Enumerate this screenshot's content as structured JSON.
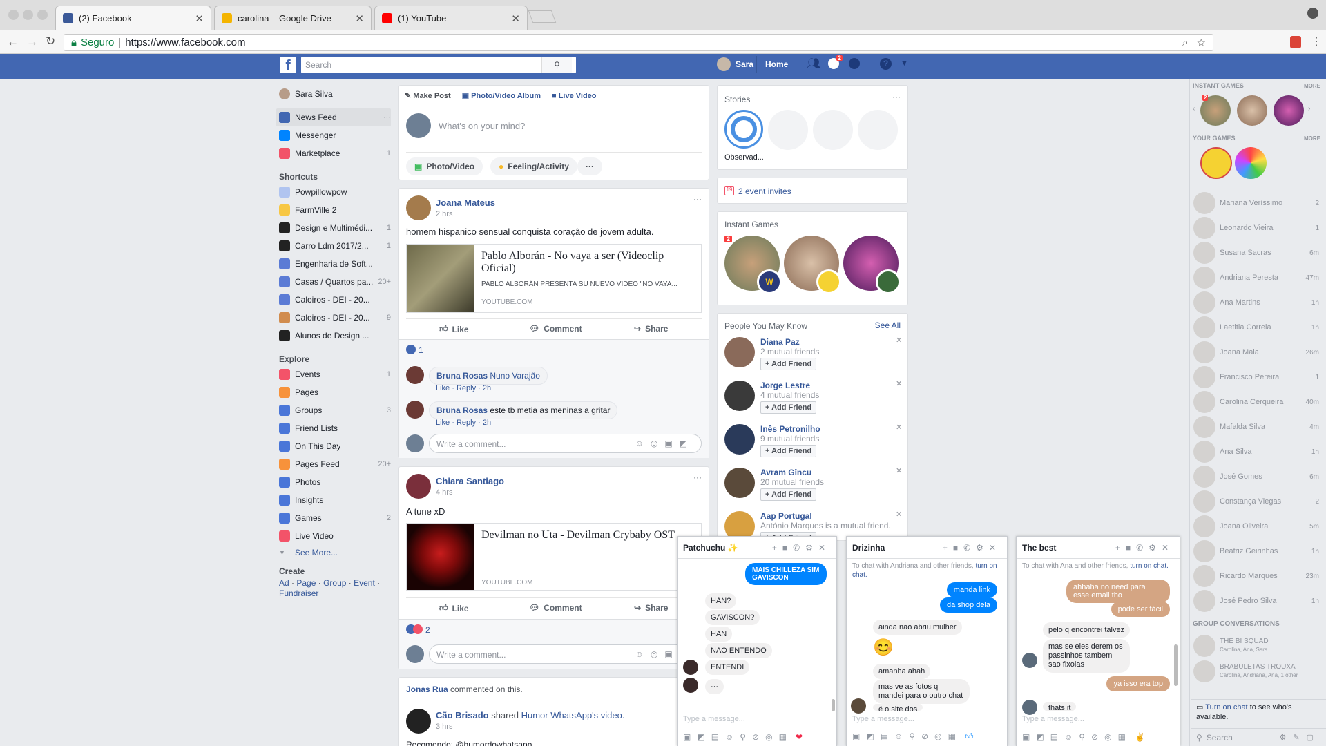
{
  "browser": {
    "tabs": [
      {
        "label": "(2) Facebook",
        "color": "#3b5998"
      },
      {
        "label": "carolina – Google Drive",
        "color": "#f4b400"
      },
      {
        "label": "(1) YouTube",
        "color": "#ff0000"
      }
    ],
    "secure_label": "Seguro",
    "url": "https://www.facebook.com"
  },
  "topbar": {
    "search_placeholder": "Search",
    "user": "Sara",
    "home": "Home",
    "messenger_badge": "2"
  },
  "left": {
    "profile_name": "Sara Silva",
    "main": [
      {
        "label": "News Feed",
        "count": "···",
        "color": "#4267b2"
      },
      {
        "label": "Messenger",
        "count": "",
        "color": "#0084ff"
      },
      {
        "label": "Marketplace",
        "count": "1",
        "color": "#f25268"
      }
    ],
    "shortcuts_title": "Shortcuts",
    "shortcuts": [
      {
        "label": "Powpillowpow",
        "count": "",
        "color": "#b0c4f0"
      },
      {
        "label": "FarmVille 2",
        "count": "",
        "color": "#f7c744"
      },
      {
        "label": "Design e Multimédi...",
        "count": "1",
        "color": "#222"
      },
      {
        "label": "Carro Ldm 2017/2...",
        "count": "1",
        "color": "#222"
      },
      {
        "label": "Engenharia de Soft...",
        "count": "",
        "color": "#5b7bd5"
      },
      {
        "label": "Casas / Quartos pa...",
        "count": "20+",
        "color": "#5b7bd5"
      },
      {
        "label": "Caloiros - DEI - 20...",
        "count": "",
        "color": "#5b7bd5"
      },
      {
        "label": "Caloiros - DEI - 20...",
        "count": "9",
        "color": "#d18c4e"
      },
      {
        "label": "Alunos de Design ...",
        "count": "",
        "color": "#222"
      }
    ],
    "explore_title": "Explore",
    "explore": [
      {
        "label": "Events",
        "count": "1",
        "color": "#f35369"
      },
      {
        "label": "Pages",
        "count": "",
        "color": "#f7923b"
      },
      {
        "label": "Groups",
        "count": "3",
        "color": "#4a76d8"
      },
      {
        "label": "Friend Lists",
        "count": "",
        "color": "#4a76d8"
      },
      {
        "label": "On This Day",
        "count": "",
        "color": "#4a76d8"
      },
      {
        "label": "Pages Feed",
        "count": "20+",
        "color": "#f7923b"
      },
      {
        "label": "Photos",
        "count": "",
        "color": "#4a76d8"
      },
      {
        "label": "Insights",
        "count": "",
        "color": "#4a76d8"
      },
      {
        "label": "Games",
        "count": "2",
        "color": "#4a76d8"
      },
      {
        "label": "Live Video",
        "count": "",
        "color": "#f35369"
      }
    ],
    "see_more": "See More...",
    "create_title": "Create",
    "create_links": [
      "Ad",
      "Page",
      "Group",
      "Event",
      "Fundraiser"
    ]
  },
  "composer": {
    "tabs": [
      "Make Post",
      "Photo/Video Album",
      "Live Video"
    ],
    "placeholder": "What's on your mind?",
    "buttons": [
      "Photo/Video",
      "Feeling/Activity",
      "···"
    ]
  },
  "posts": [
    {
      "author": "Joana Mateus",
      "time": "2 hrs",
      "text": "homem hispanico sensual conquista coração de jovem adulta.",
      "link_title": "Pablo Alborán - No vaya a ser (Videoclip Oficial)",
      "link_desc": "PABLO ALBORÁN PRESENTA SU NUEVO VÍDEO \"NO VAYA...",
      "link_domain": "YOUTUBE.COM",
      "reactions": "1",
      "comments": [
        {
          "author": "Bruna Rosas",
          "text": "Nuno Varajão",
          "meta": "Like · Reply · 2h"
        },
        {
          "author": "Bruna Rosas",
          "text": "este tb metia as meninas a gritar",
          "meta": "Like · Reply · 2h"
        }
      ]
    },
    {
      "author": "Chiara Santiago",
      "time": "4 hrs",
      "text": "A tune xD",
      "link_title": "Devilman no Uta - Devilman Crybaby OST",
      "link_domain": "YOUTUBE.COM",
      "reactions": "2"
    }
  ],
  "post_actions": {
    "like": "Like",
    "comment": "Comment",
    "share": "Share",
    "write_comment": "Write a comment..."
  },
  "activity": {
    "actor": "Jonas Rua",
    "action": "commented on this.",
    "sharer": "Cão Brisado",
    "shared": "shared",
    "page": "Humor WhatsApp",
    "video": "'s video.",
    "time": "3 hrs",
    "text": "Recomendo: @humordowhatsapp"
  },
  "right": {
    "stories_title": "Stories",
    "story_label": "Observad...",
    "events": "2 event invites",
    "games_title": "Instant Games",
    "games_badge": "2",
    "pymk_title": "People You May Know",
    "see_all": "See All",
    "people": [
      {
        "name": "Diana Paz",
        "mutual": "2 mutual friends"
      },
      {
        "name": "Jorge Lestre",
        "mutual": "4 mutual friends"
      },
      {
        "name": "Inês Petronilho",
        "mutual": "9 mutual friends"
      },
      {
        "name": "Avram Gîncu",
        "mutual": "20 mutual friends"
      },
      {
        "name": "Aap Portugal",
        "mutual": "António Marques is a mutual friend."
      }
    ],
    "add_friend": "Add Friend"
  },
  "chatside": {
    "instant_games": "INSTANT GAMES",
    "more": "MORE",
    "your_games": "YOUR GAMES",
    "games_badge": "2",
    "friends": [
      {
        "name": "Mariana Veríssimo",
        "time": "2"
      },
      {
        "name": "Leonardo Vieira",
        "time": "1"
      },
      {
        "name": "Susana Sacras",
        "time": "6m"
      },
      {
        "name": "Andriana Peresta",
        "time": "47m"
      },
      {
        "name": "Ana Martins",
        "time": "1h"
      },
      {
        "name": "Laetitia Correia",
        "time": "1h"
      },
      {
        "name": "Joana Maia",
        "time": "26m"
      },
      {
        "name": "Francisco Pereira",
        "time": "1"
      },
      {
        "name": "Carolina Cerqueira",
        "time": "40m"
      },
      {
        "name": "Mafalda Silva",
        "time": "4m"
      },
      {
        "name": "Ana Silva",
        "time": "1h"
      },
      {
        "name": "José Gomes",
        "time": "6m"
      },
      {
        "name": "Constança Viegas",
        "time": "2"
      },
      {
        "name": "Joana Oliveira",
        "time": "5m"
      },
      {
        "name": "Beatriz Geirinhas",
        "time": "1h"
      },
      {
        "name": "Ricardo Marques",
        "time": "23m"
      },
      {
        "name": "José Pedro Silva",
        "time": "1h"
      }
    ],
    "group_title": "GROUP CONVERSATIONS",
    "groups": [
      {
        "name": "THE BI SQUAD",
        "members": "Carolina, Ana, Sara"
      },
      {
        "name": "BRABULETAS TROUXA",
        "members": "Carolina, Andriana, Ana, 1 other"
      }
    ],
    "turn_on": "Turn on chat",
    "turn_on_rest": "to see who's available.",
    "search": "Search"
  },
  "chats": [
    {
      "title": "Patchuchu ✨",
      "messages": [
        "MAIS CHILLEZA SIM GAVISCON",
        "HAN?",
        "GAVISCON?",
        "HAN",
        "NAO ENTENDO",
        "ENTENDI",
        "···"
      ]
    },
    {
      "title": "Drizinha",
      "notice": "To chat with Andriana and other friends,",
      "notice_link": "turn on chat.",
      "messages": [
        "manda link",
        "da shop dela",
        "ainda nao abriu mulher",
        "😊",
        "amanha ahah",
        "mas ve as fotos q mandei para o outro chat",
        "é o site dos"
      ]
    },
    {
      "title": "The best",
      "notice": "To chat with Ana and other friends,",
      "notice_link": "turn on chat.",
      "messages": [
        "ahhaha no need para esse email tho",
        "pode ser fácil",
        "pelo q encontrei talvez",
        "mas se eles derem os passinhos tambem sao fixolas",
        "ya isso era top",
        "thats it"
      ]
    }
  ],
  "chat_placeholder": "Type a message..."
}
